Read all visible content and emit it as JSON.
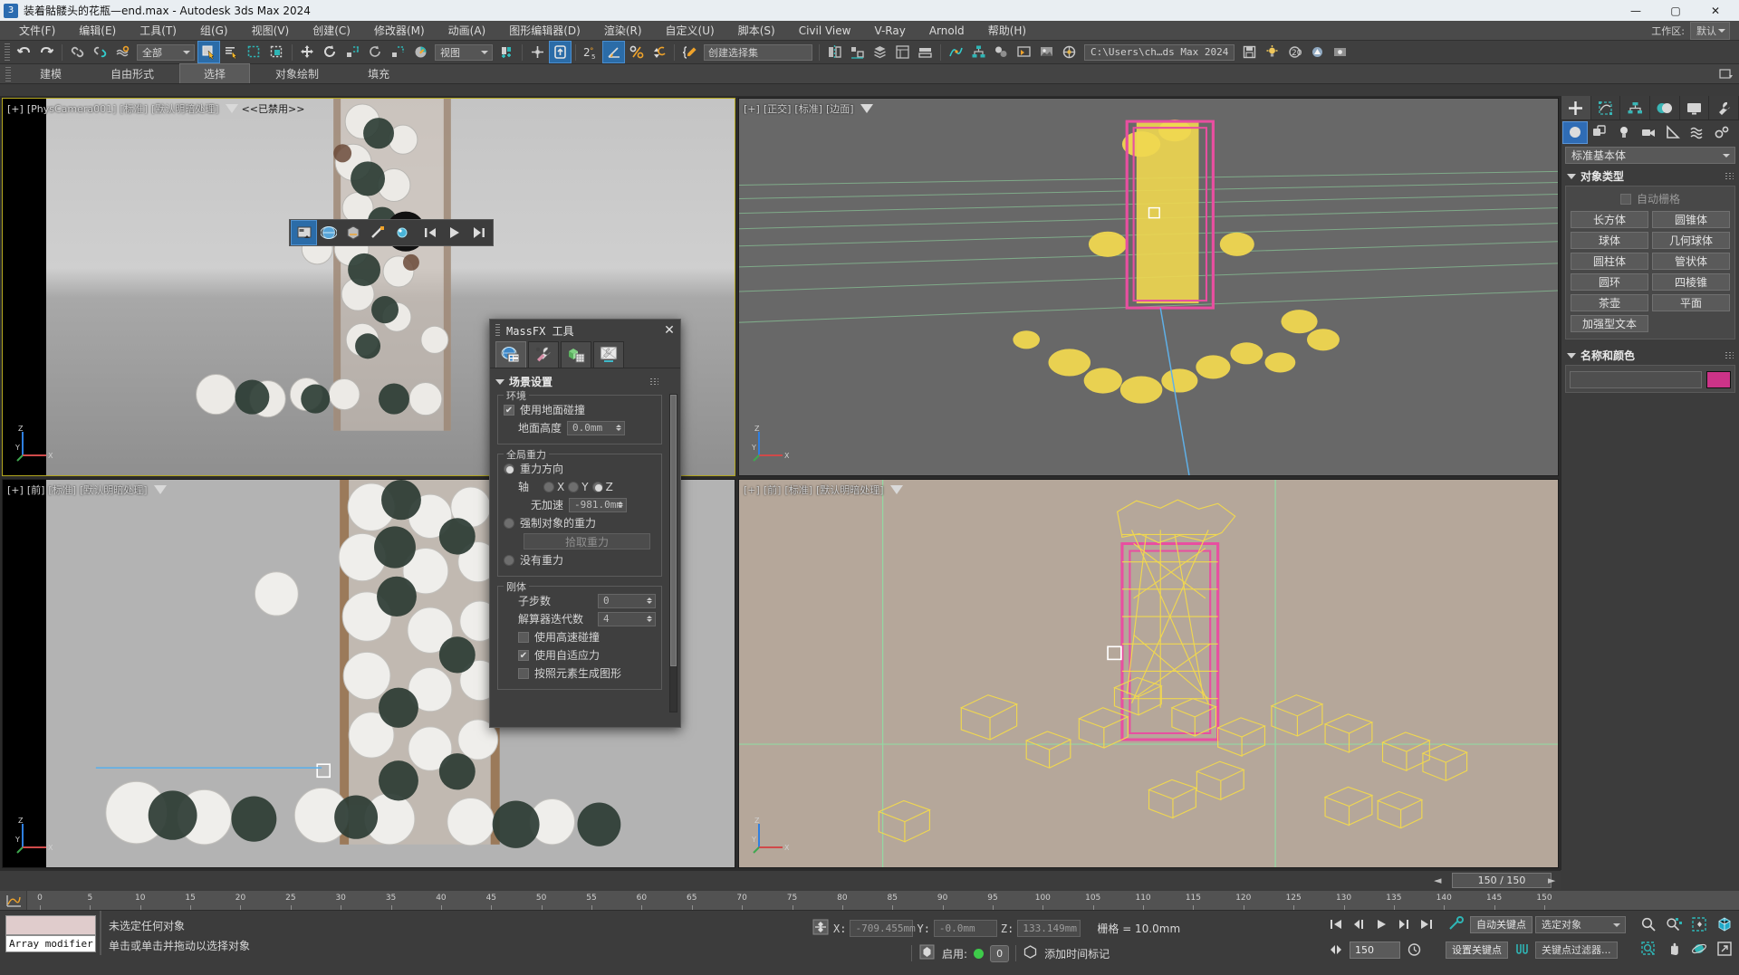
{
  "window": {
    "title": "装着骷髅头的花瓶—end.max - Autodesk 3ds Max 2024",
    "app_icon": "3",
    "minimize": "—",
    "maximize": "▢",
    "close": "✕"
  },
  "menu": {
    "items": [
      {
        "label": "文件(F)"
      },
      {
        "label": "编辑(E)"
      },
      {
        "label": "工具(T)"
      },
      {
        "label": "组(G)"
      },
      {
        "label": "视图(V)"
      },
      {
        "label": "创建(C)"
      },
      {
        "label": "修改器(M)"
      },
      {
        "label": "动画(A)"
      },
      {
        "label": "图形编辑器(D)"
      },
      {
        "label": "渲染(R)"
      },
      {
        "label": "自定义(U)"
      },
      {
        "label": "脚本(S)"
      },
      {
        "label": "Civil View"
      },
      {
        "label": "V-Ray"
      },
      {
        "label": "Arnold"
      },
      {
        "label": "帮助(H)"
      }
    ],
    "workspace_label": "工作区:",
    "workspace_value": "默认"
  },
  "toolbar": {
    "selection_filter": "全部",
    "reference_coord": "视图",
    "named_selection_placeholder": "创建选择集",
    "project_path": "C:\\Users\\ch…ds Max 2024",
    "snap_percent": "%",
    "angle_snap": "2.5",
    "spinner_snap": "5",
    "icons": [
      "undo-icon",
      "redo-icon",
      "link-icon",
      "unlink-icon",
      "bind-space-warp-icon",
      "select-object-icon",
      "select-by-name-icon",
      "rect-select-region-icon",
      "window-crossing-icon",
      "select-move-icon",
      "select-rotate-icon",
      "select-scale-icon",
      "placement-icon",
      "snaps-toggle-icon",
      "angle-snap-icon",
      "percent-snap-icon",
      "spinner-snap-icon",
      "mirror-icon",
      "align-icon",
      "layer-explorer-icon",
      "curve-editor-icon",
      "schematic-view-icon",
      "material-editor-icon",
      "render-setup-icon",
      "render-frame-icon",
      "render-production-icon"
    ]
  },
  "ribbon": {
    "tabs": [
      {
        "label": "建模",
        "active": false
      },
      {
        "label": "自由形式",
        "active": false
      },
      {
        "label": "选择",
        "active": true
      },
      {
        "label": "对象绘制",
        "active": false
      },
      {
        "label": "填充",
        "active": false
      }
    ]
  },
  "viewports": [
    {
      "id": "vp-perspective-camera",
      "label_plus": "[+]",
      "label_view": "[PhysCamera001]",
      "label_shading": "[标准]",
      "label_mode": "[默认明暗处理]",
      "extra": "<<已禁用>>",
      "active": true
    },
    {
      "id": "vp-orthographic",
      "label_plus": "[+]",
      "label_view": "[正交]",
      "label_shading": "[标准]",
      "label_mode": "[边面]",
      "extra": "",
      "active": false
    },
    {
      "id": "vp-front-left",
      "label_plus": "[+]",
      "label_view": "[前]",
      "label_shading": "[标准]",
      "label_mode": "[默认明暗处理]",
      "extra": "",
      "active": false
    },
    {
      "id": "vp-front-right",
      "label_plus": "[+]",
      "label_view": "[前]",
      "label_shading": "[标准]",
      "label_mode": "[默认明暗处理]",
      "extra": "",
      "active": false
    }
  ],
  "command_panel": {
    "tabs": [
      {
        "name": "create-tab",
        "icon": "plus-icon",
        "selected": true
      },
      {
        "name": "modify-tab",
        "icon": "modify-icon",
        "selected": false
      },
      {
        "name": "hierarchy-tab",
        "icon": "hierarchy-icon",
        "selected": false
      },
      {
        "name": "motion-tab",
        "icon": "motion-icon",
        "selected": false
      },
      {
        "name": "display-tab",
        "icon": "display-icon",
        "selected": false
      },
      {
        "name": "utilities-tab",
        "icon": "wrench-icon",
        "selected": false
      }
    ],
    "subtabs": [
      {
        "name": "geometry-subtab",
        "icon": "sphere-icon",
        "selected": true
      },
      {
        "name": "shapes-subtab",
        "icon": "shapes-icon",
        "selected": false
      },
      {
        "name": "lights-subtab",
        "icon": "light-bulb-icon",
        "selected": false
      },
      {
        "name": "cameras-subtab",
        "icon": "camera-icon",
        "selected": false
      },
      {
        "name": "helpers-subtab",
        "icon": "helper-icon",
        "selected": false
      },
      {
        "name": "space-warps-subtab",
        "icon": "space-warp-icon",
        "selected": false
      },
      {
        "name": "systems-subtab",
        "icon": "systems-icon",
        "selected": false
      }
    ],
    "category": "标准基本体",
    "object_type": {
      "title": "对象类型",
      "autogrid_label": "自动栅格",
      "autogrid_checked": false,
      "buttons": [
        "长方体",
        "圆锥体",
        "球体",
        "几何球体",
        "圆柱体",
        "管状体",
        "圆环",
        "四棱锥",
        "茶壶",
        "平面",
        "加强型文本"
      ]
    },
    "name_and_color": {
      "title": "名称和颜色",
      "name_value": "",
      "color": "#cc3388"
    }
  },
  "massfx_dialog": {
    "title": "MassFX 工具",
    "close_icon": "close-icon",
    "tabs": [
      {
        "name": "world-settings-tab",
        "icon": "world-icon",
        "selected": true
      },
      {
        "name": "tools-tab",
        "icon": "tools-icon",
        "selected": false
      },
      {
        "name": "multi-object-tab",
        "icon": "multi-object-icon",
        "selected": false
      },
      {
        "name": "display-options-tab",
        "icon": "display-options-icon",
        "selected": false
      }
    ],
    "rollout_title": "场景设置",
    "environment": {
      "group_label": "环境",
      "use_ground_collision_label": "使用地面碰撞",
      "use_ground_collision_checked": true,
      "ground_height_label": "地面高度",
      "ground_height_value": "0.0mm"
    },
    "global_gravity": {
      "group_label": "全局重力",
      "gravity_direction_label": "重力方向",
      "gravity_direction_selected": true,
      "axis_label": "轴",
      "axis_options": [
        "X",
        "Y",
        "Z"
      ],
      "axis_selected": "Z",
      "acceleration_label": "无加速",
      "acceleration_value": "-981.0mm",
      "forced_gravity_label": "强制对象的重力",
      "forced_gravity_selected": false,
      "pick_gravity_button": "拾取重力",
      "no_gravity_label": "没有重力",
      "no_gravity_selected": false
    },
    "rigid_body": {
      "group_label": "刚体",
      "substeps_label": "子步数",
      "substeps_value": "0",
      "solver_iterations_label": "解算器迭代数",
      "solver_iterations_value": "4",
      "high_velocity_label": "使用高速碰撞",
      "high_velocity_checked": false,
      "adaptive_force_label": "使用自适应力",
      "adaptive_force_checked": true,
      "generate_shapes_label": "按照元素生成图形",
      "generate_shapes_checked": false
    }
  },
  "time_slider": {
    "value": "150 / 150",
    "prev_icon": "prev-frame-icon",
    "next_icon": "next-frame-icon"
  },
  "track_bar": {
    "ticks": [
      "0",
      "5",
      "10",
      "15",
      "20",
      "25",
      "30",
      "35",
      "40",
      "45",
      "50",
      "55",
      "60",
      "65",
      "70",
      "75",
      "80",
      "85",
      "90",
      "95",
      "100",
      "105",
      "110",
      "115",
      "120",
      "125",
      "130",
      "135",
      "140",
      "145",
      "150"
    ],
    "min": 0,
    "max": 150
  },
  "status_bar": {
    "maxscript_listener_value": "Array modifier",
    "selection_status": "未选定任何对象",
    "prompt": "单击或单击并拖动以选择对象",
    "coords": {
      "x_label": "X:",
      "x_value": "-709.455mm",
      "y_label": "Y:",
      "y_value": "-0.0mm",
      "z_label": "Z:",
      "z_value": "133.149mm"
    },
    "grid_text": "栅格 = 10.0mm",
    "enable_label": "启用:",
    "enable_count": "0",
    "add_time_tag": "添加时间标记",
    "frame_field": "150",
    "auto_key": "自动关键点",
    "set_key": "设置关键点",
    "key_filters": "关键点过滤器...",
    "selection_set": "选定对象",
    "nav_icons": [
      "zoom-icon",
      "zoom-all-icon",
      "zoom-extents-icon",
      "zoom-extents-all-icon",
      "zoom-region-icon",
      "pan-icon",
      "orbit-icon",
      "maximize-viewport-icon"
    ],
    "playback_icons": [
      "go-to-start-icon",
      "previous-frame-icon",
      "play-icon",
      "next-frame-icon",
      "go-to-end-icon",
      "key-mode-icon"
    ]
  }
}
